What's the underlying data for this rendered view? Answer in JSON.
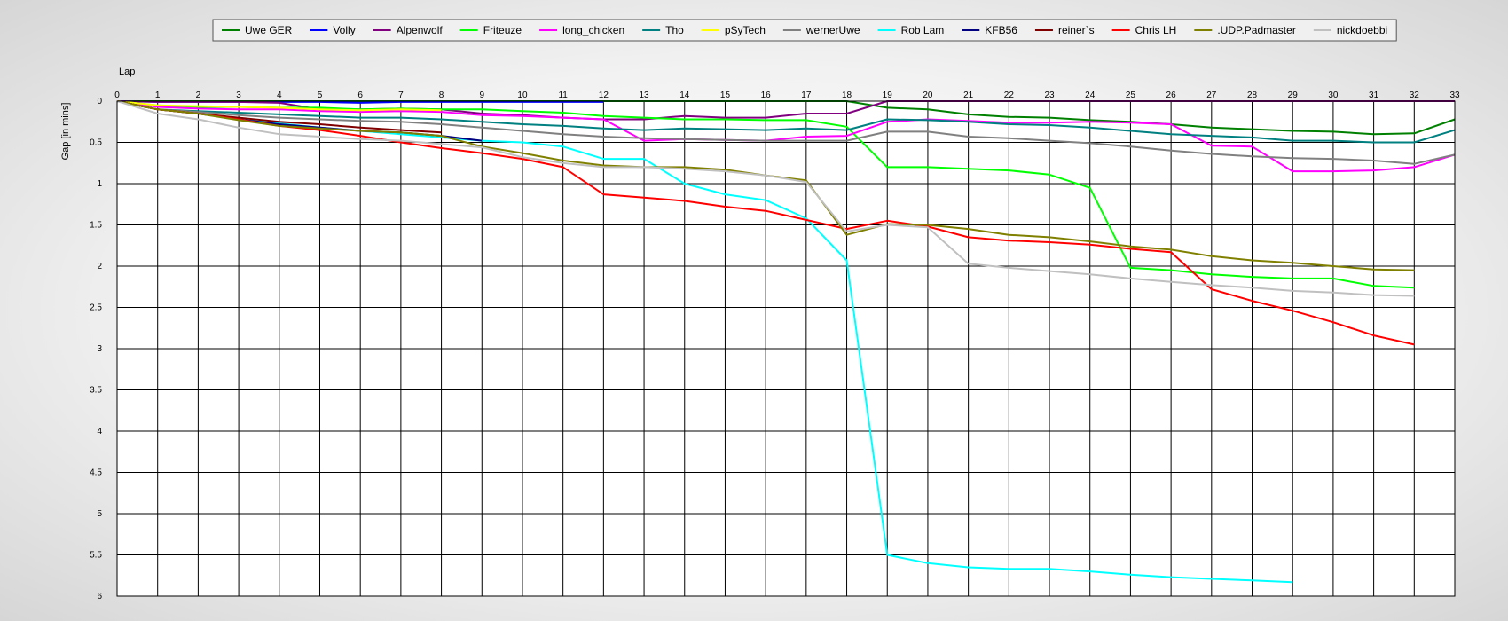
{
  "chart_data": {
    "type": "line",
    "xlabel": "Lap",
    "ylabel": "Gap [in mins]",
    "xlim": [
      0,
      33
    ],
    "ylim": [
      0,
      6
    ],
    "y_inverted": true,
    "grid": true,
    "legend_position": "top-center",
    "x_ticks": [
      0,
      1,
      2,
      3,
      4,
      5,
      6,
      7,
      8,
      9,
      10,
      11,
      12,
      13,
      14,
      15,
      16,
      17,
      18,
      19,
      20,
      21,
      22,
      23,
      24,
      25,
      26,
      27,
      28,
      29,
      30,
      31,
      32,
      33
    ],
    "y_ticks": [
      0,
      0.5,
      1,
      1.5,
      2,
      2.5,
      3,
      3.5,
      4,
      4.5,
      5,
      5.5,
      6
    ],
    "y_tick_labels": [
      "0",
      "0.5",
      "1",
      "1.5",
      "2",
      "2.5",
      "3",
      "3.5",
      "4",
      "4.5",
      "5",
      "5.5",
      "6"
    ],
    "series": [
      {
        "name": "Uwe GER",
        "color": "#008000",
        "x": [
          0,
          1,
          2,
          3,
          4,
          5,
          6,
          7,
          8,
          9,
          10,
          11,
          12,
          13,
          14,
          15,
          16,
          17,
          18,
          19,
          20,
          21,
          22,
          23,
          24,
          25,
          26,
          27,
          28,
          29,
          30,
          31,
          32,
          33
        ],
        "values": [
          0,
          0,
          0,
          0,
          0,
          0,
          0,
          0,
          0,
          0,
          0,
          0,
          0,
          0,
          0,
          0,
          0,
          0,
          0,
          0.08,
          0.1,
          0.16,
          0.19,
          0.2,
          0.23,
          0.25,
          0.28,
          0.32,
          0.34,
          0.36,
          0.37,
          0.4,
          0.39,
          0.22
        ]
      },
      {
        "name": "Volly",
        "color": "#0000ff",
        "x": [
          0,
          1,
          2,
          3,
          4,
          5,
          6,
          7,
          8,
          9,
          10,
          11,
          12
        ],
        "values": [
          0,
          0.01,
          0.01,
          0.01,
          0.01,
          0.01,
          0.02,
          0.01,
          0.01,
          0.01,
          0.01,
          0.01,
          0.01
        ]
      },
      {
        "name": "Alpenwolf",
        "color": "#800080",
        "x": [
          0,
          1,
          2,
          3,
          4,
          5,
          6,
          7,
          8,
          9,
          10,
          11,
          12,
          13,
          14,
          15,
          16,
          17,
          18,
          19,
          20,
          21,
          22,
          23,
          24,
          25,
          26,
          27,
          28,
          29,
          30,
          31,
          32,
          33
        ],
        "values": [
          0,
          0.01,
          0.01,
          0.01,
          0.02,
          0.1,
          0.1,
          0.09,
          0.1,
          0.15,
          0.17,
          0.2,
          0.22,
          0.22,
          0.18,
          0.2,
          0.2,
          0.15,
          0.15,
          0,
          0,
          0,
          0,
          0,
          0,
          0,
          0,
          0,
          0,
          0,
          0,
          0,
          0,
          0
        ]
      },
      {
        "name": "Friteuze",
        "color": "#00ff00",
        "x": [
          0,
          1,
          2,
          3,
          4,
          5,
          6,
          7,
          8,
          9,
          10,
          11,
          12,
          13,
          14,
          15,
          16,
          17,
          18,
          19,
          20,
          21,
          22,
          23,
          24,
          25,
          26,
          27,
          28,
          29,
          30,
          31,
          32
        ],
        "values": [
          0,
          0.05,
          0.07,
          0.07,
          0.08,
          0.08,
          0.1,
          0.09,
          0.1,
          0.1,
          0.12,
          0.14,
          0.18,
          0.2,
          0.22,
          0.22,
          0.23,
          0.23,
          0.31,
          0.8,
          0.8,
          0.82,
          0.84,
          0.89,
          1.05,
          2.02,
          2.05,
          2.1,
          2.13,
          2.15,
          2.15,
          2.24,
          2.26
        ]
      },
      {
        "name": "long_chicken",
        "color": "#ff00ff",
        "x": [
          0,
          1,
          2,
          3,
          4,
          5,
          6,
          7,
          8,
          9,
          10,
          11,
          12,
          13,
          14,
          15,
          16,
          17,
          18,
          19,
          20,
          21,
          22,
          23,
          24,
          25,
          26,
          27,
          28,
          29,
          30,
          31,
          32,
          33
        ],
        "values": [
          0,
          0.07,
          0.09,
          0.1,
          0.1,
          0.12,
          0.13,
          0.12,
          0.13,
          0.17,
          0.18,
          0.2,
          0.22,
          0.48,
          0.46,
          0.47,
          0.48,
          0.43,
          0.42,
          0.25,
          0.22,
          0.24,
          0.26,
          0.26,
          0.25,
          0.26,
          0.28,
          0.54,
          0.55,
          0.85,
          0.85,
          0.84,
          0.8,
          0.65
        ]
      },
      {
        "name": "Tho",
        "color": "#008080",
        "x": [
          0,
          1,
          2,
          3,
          4,
          5,
          6,
          7,
          8,
          9,
          10,
          11,
          12,
          13,
          14,
          15,
          16,
          17,
          18,
          19,
          20,
          21,
          22,
          23,
          24,
          25,
          26,
          27,
          28,
          29,
          30,
          31,
          32,
          33
        ],
        "values": [
          0,
          0.1,
          0.12,
          0.14,
          0.16,
          0.18,
          0.2,
          0.2,
          0.22,
          0.25,
          0.28,
          0.3,
          0.33,
          0.35,
          0.33,
          0.34,
          0.35,
          0.33,
          0.35,
          0.22,
          0.23,
          0.25,
          0.28,
          0.29,
          0.32,
          0.36,
          0.4,
          0.42,
          0.44,
          0.48,
          0.48,
          0.5,
          0.5,
          0.35
        ]
      },
      {
        "name": "pSyTech",
        "color": "#ffff00",
        "x": [
          0,
          1,
          2,
          3,
          4,
          5,
          6,
          7,
          8
        ],
        "values": [
          0,
          0.05,
          0.06,
          0.07,
          0.08,
          0.1,
          0.11,
          0.1,
          0.11
        ]
      },
      {
        "name": "wernerUwe",
        "color": "#808080",
        "x": [
          0,
          1,
          2,
          3,
          4,
          5,
          6,
          7,
          8,
          9,
          10,
          11,
          12,
          13,
          14,
          15,
          16,
          17,
          18,
          19,
          20,
          21,
          22,
          23,
          24,
          25,
          26,
          27,
          28,
          29,
          30,
          31,
          32,
          33
        ],
        "values": [
          0,
          0.1,
          0.13,
          0.17,
          0.2,
          0.22,
          0.24,
          0.25,
          0.28,
          0.32,
          0.36,
          0.4,
          0.43,
          0.45,
          0.46,
          0.47,
          0.48,
          0.48,
          0.48,
          0.37,
          0.37,
          0.43,
          0.45,
          0.48,
          0.51,
          0.55,
          0.6,
          0.64,
          0.67,
          0.69,
          0.7,
          0.72,
          0.76,
          0.65
        ]
      },
      {
        "name": "Rob Lam",
        "color": "#00ffff",
        "x": [
          0,
          1,
          2,
          3,
          4,
          5,
          6,
          7,
          8,
          9,
          10,
          11,
          12,
          13,
          14,
          15,
          16,
          17,
          18,
          19,
          20,
          21,
          22,
          23,
          24,
          25,
          26,
          27,
          28,
          29
        ],
        "values": [
          0,
          0.1,
          0.15,
          0.22,
          0.27,
          0.32,
          0.36,
          0.4,
          0.44,
          0.48,
          0.5,
          0.55,
          0.7,
          0.7,
          1.0,
          1.13,
          1.2,
          1.42,
          1.93,
          5.5,
          5.6,
          5.65,
          5.67,
          5.67,
          5.7,
          5.74,
          5.77,
          5.79,
          5.81,
          5.83
        ]
      },
      {
        "name": "KFB56",
        "color": "#000080",
        "x": [
          0,
          1,
          2,
          3,
          4,
          5,
          6,
          7,
          8,
          9
        ],
        "values": [
          0,
          0.1,
          0.15,
          0.22,
          0.28,
          0.32,
          0.36,
          0.38,
          0.42,
          0.48
        ]
      },
      {
        "name": "reiner`s",
        "color": "#800000",
        "x": [
          0,
          1,
          2,
          3,
          4,
          5,
          6,
          7,
          8
        ],
        "values": [
          0,
          0.1,
          0.15,
          0.2,
          0.25,
          0.28,
          0.32,
          0.35,
          0.38
        ]
      },
      {
        "name": "Chris LH",
        "color": "#ff0000",
        "x": [
          0,
          1,
          2,
          3,
          4,
          5,
          6,
          7,
          8,
          9,
          10,
          11,
          12,
          13,
          14,
          15,
          16,
          17,
          18,
          19,
          20,
          21,
          22,
          23,
          24,
          25,
          26,
          27,
          28,
          29,
          30,
          31,
          32
        ],
        "values": [
          0,
          0.1,
          0.15,
          0.22,
          0.3,
          0.35,
          0.42,
          0.5,
          0.57,
          0.63,
          0.7,
          0.8,
          1.13,
          1.17,
          1.21,
          1.28,
          1.33,
          1.44,
          1.55,
          1.45,
          1.52,
          1.65,
          1.69,
          1.71,
          1.74,
          1.79,
          1.83,
          2.28,
          2.42,
          2.54,
          2.68,
          2.84,
          2.95
        ]
      },
      {
        "name": ".UDP.Padmaster",
        "color": "#808000",
        "x": [
          0,
          1,
          2,
          3,
          4,
          5,
          6,
          7,
          8,
          9,
          10,
          11,
          12,
          13,
          14,
          15,
          16,
          17,
          18,
          19,
          20,
          21,
          22,
          23,
          24,
          25,
          26,
          27,
          28,
          29,
          30,
          31,
          32
        ],
        "values": [
          0,
          0.1,
          0.15,
          0.23,
          0.3,
          0.33,
          0.36,
          0.38,
          0.42,
          0.55,
          0.63,
          0.72,
          0.78,
          0.8,
          0.8,
          0.83,
          0.9,
          0.96,
          1.62,
          1.49,
          1.5,
          1.55,
          1.62,
          1.65,
          1.7,
          1.76,
          1.8,
          1.88,
          1.93,
          1.96,
          2.0,
          2.04,
          2.05
        ]
      },
      {
        "name": "nickdoebbi",
        "color": "#c0c0c0",
        "x": [
          0,
          1,
          2,
          3,
          4,
          5,
          6,
          7,
          8,
          9,
          10,
          11,
          12,
          13,
          14,
          15,
          16,
          17,
          18,
          19,
          20,
          21,
          22,
          23,
          24,
          25,
          26,
          27,
          28,
          29,
          30,
          31,
          32
        ],
        "values": [
          0,
          0.15,
          0.22,
          0.32,
          0.4,
          0.43,
          0.46,
          0.48,
          0.52,
          0.56,
          0.68,
          0.75,
          0.8,
          0.8,
          0.82,
          0.85,
          0.9,
          0.98,
          1.58,
          1.5,
          1.53,
          1.97,
          2.02,
          2.06,
          2.1,
          2.15,
          2.19,
          2.23,
          2.26,
          2.3,
          2.32,
          2.35,
          2.36
        ]
      }
    ]
  }
}
